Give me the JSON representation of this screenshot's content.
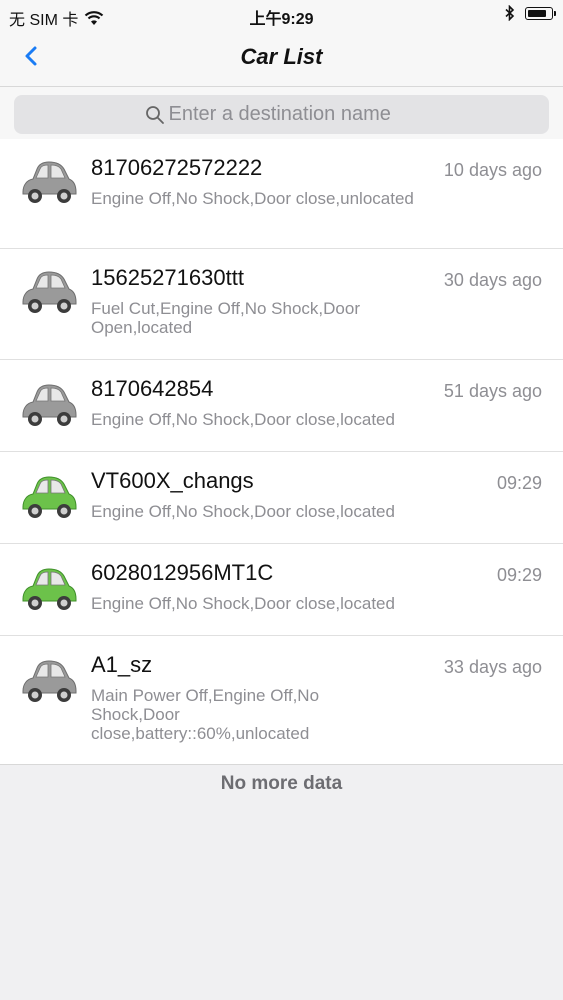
{
  "status_bar": {
    "carrier": "无 SIM 卡",
    "time": "上午9:29",
    "icons": [
      "wifi-icon",
      "bluetooth-icon",
      "battery-icon"
    ]
  },
  "nav": {
    "title": "Car List",
    "back_icon": "chevron-left-icon"
  },
  "search": {
    "placeholder": "Enter a destination name",
    "icon": "search-icon"
  },
  "cars": [
    {
      "name": "81706272572222",
      "status": "Engine Off,No Shock,Door close,unlocated",
      "time": "10 days ago",
      "icon_color": "gray"
    },
    {
      "name": "15625271630ttt",
      "status": "Fuel Cut,Engine Off,No Shock,Door Open,located",
      "time": "30 days ago",
      "icon_color": "gray"
    },
    {
      "name": "8170642854",
      "status": "Engine Off,No Shock,Door close,located",
      "time": "51 days ago",
      "icon_color": "gray"
    },
    {
      "name": "VT600X_changs",
      "status": "Engine Off,No Shock,Door close,located",
      "time": "09:29",
      "icon_color": "green"
    },
    {
      "name": "6028012956MT1C",
      "status": "Engine Off,No Shock,Door close,located",
      "time": "09:29",
      "icon_color": "green"
    },
    {
      "name": "A1_sz",
      "status": "Main Power Off,Engine Off,No Shock,Door close,battery::60%,unlocated",
      "time": "33 days ago",
      "icon_color": "gray"
    }
  ],
  "footer": {
    "text": "No more data"
  },
  "colors": {
    "accent": "#1a7cf5",
    "car_gray": "#9a9a9a",
    "car_green": "#6cc24a",
    "secondary_text": "#8e8e93"
  }
}
